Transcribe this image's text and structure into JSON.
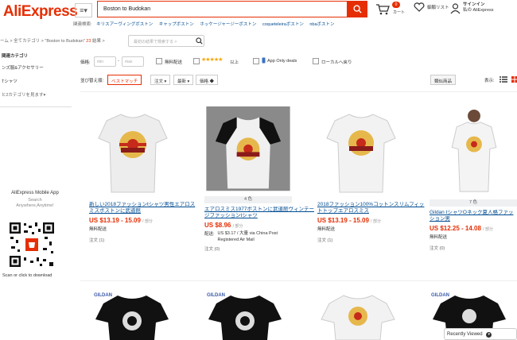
{
  "header": {
    "logo": "AliExpress",
    "menu_label": "≡▾",
    "search_value": "Boston to Budokan",
    "cart_count": "0",
    "cart_label": "カート",
    "wishlist_label": "御願リスト",
    "signin_line1": "サインイン",
    "signin_line2": "私の AliExpress"
  },
  "related": {
    "label": "関連検索:",
    "links": [
      "キリスアーヴィングボストン",
      "キャップボストン",
      "ホッケージャージーボストン",
      "coqueteleiraボストン",
      "nbaボストン"
    ]
  },
  "breadcrumb": {
    "text": "ーム > 全てカテゴリ > \"Boston to Budokan\"",
    "count": "23",
    "suffix": "結果 >",
    "refine_placeholder": "最初の結果で検索する >"
  },
  "sidebar": {
    "heading": "関連カテゴリ",
    "items": [
      "ンズ服&アクセサリー",
      "Tシャツ"
    ],
    "more": "ヒ2カテゴリを見ます▾"
  },
  "filters": {
    "price_label": "価格:",
    "min_placeholder": "min",
    "max_placeholder": "max",
    "free_shipping": "無料配送",
    "stars_glyph": "★★★★★",
    "rating_suffix": "以上",
    "app_only": "App Only deals",
    "local_return": "ローカルへ戻り"
  },
  "sort": {
    "label": "並び替え順:",
    "best_match": "ベストマッチ",
    "orders": "注文",
    "newest": "最新",
    "price": "価格",
    "similar_btn": "類似商品",
    "view_label": "表示:"
  },
  "products": [
    {
      "title": "新しい2018ファッションtシャツ男性エアロスミスボストンに武道館",
      "price": "US $13.19 - 15.09",
      "unit": "/ 部分",
      "shipping": "無料配送",
      "orders": "注文 (1)"
    },
    {
      "color_count": "4 色",
      "title": "エアロスミス1977ボストンに武道館ヴィンテージファッションtシャツ",
      "price": "US $8.96",
      "unit": "/ 部分",
      "ship_label": "配送:",
      "ship_detail": "US $3.17 / 大量 via China Post Registered Air Mail",
      "orders": "注文 (0)"
    },
    {
      "title": "2018ファッション100%コットンスリムフィットトップエアロスミス",
      "price": "US $13.19 - 15.09",
      "unit": "/ 部分",
      "shipping": "無料配送",
      "orders": "注文 (1)"
    },
    {
      "color_count": "7 色",
      "title": "Gildan tシャツOネック夏人格ファッション男",
      "price": "US $12.25 - 14.08",
      "unit": "/ 部分",
      "shipping": "無料配送",
      "orders": "注文 (0)"
    }
  ],
  "second_row_brand": "GILDAN",
  "mobile": {
    "title": "AliExpress Mobile App",
    "subtitle_1": "Search",
    "subtitle_2": "Anywhere,Anytime!",
    "scan": "Scan or click to download"
  },
  "recently_viewed": "Recently Viewed",
  "colors": {
    "accent": "#e62e04",
    "link": "#004b91"
  }
}
